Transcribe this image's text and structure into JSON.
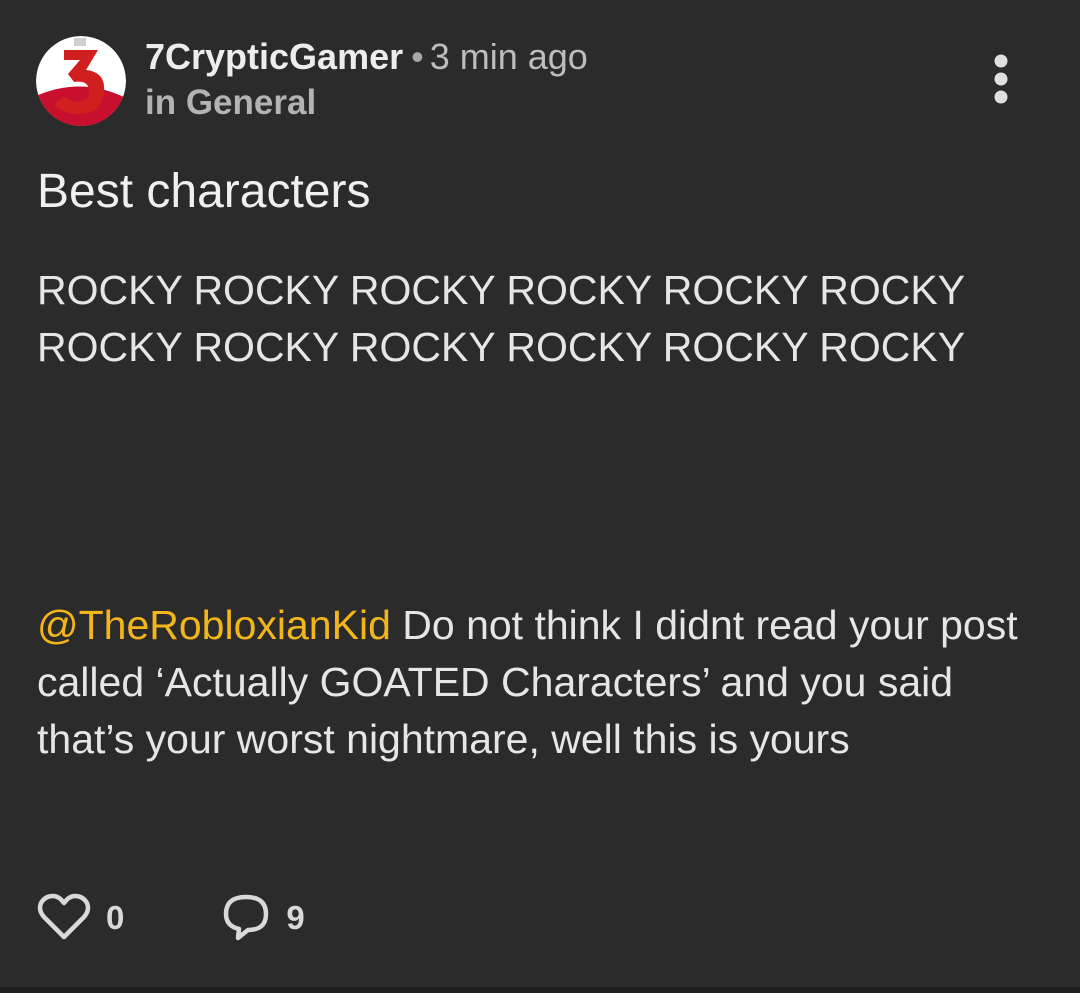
{
  "post": {
    "author": "7CrypticGamer",
    "separator": "•",
    "time_ago": "3 min ago",
    "category": "in General",
    "avatar_icon": "red-number-3-avatar",
    "title": "Best characters",
    "body_lines": [
      "ROCKY ROCKY ROCKY ROCKY ROCKY ROCKY",
      "ROCKY ROCKY ROCKY ROCKY ROCKY ROCKY"
    ],
    "mention": "@TheRobloxianKid",
    "reply_text": " Do not think I didnt read your post called ‘Actually GOATED Characters’ and you said that’s your worst nightmare, well this is yours"
  },
  "actions": {
    "likes": "0",
    "comments": "9",
    "like_icon": "heart-outline-icon",
    "comment_icon": "speech-bubble-icon",
    "menu_icon": "vertical-ellipsis-icon"
  },
  "colors": {
    "background": "#2b2b2b",
    "mention": "#f2b51c",
    "avatar_red": "#d11f1f"
  }
}
